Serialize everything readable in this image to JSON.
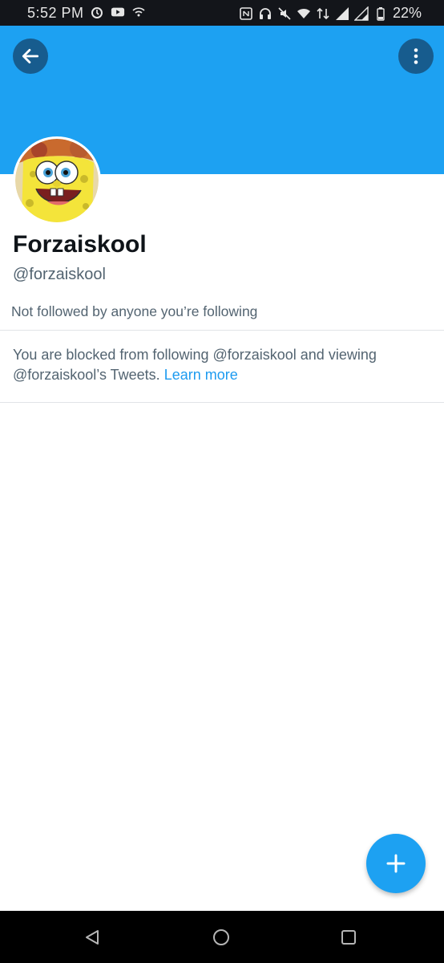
{
  "status_bar": {
    "time": "5:52 PM",
    "battery": "22%",
    "icons": [
      "alarm-icon",
      "youtube-icon",
      "wifi-icon",
      "nfc-icon",
      "headset-icon",
      "mute-icon",
      "wifi-signal-icon",
      "data-icon",
      "cell-signal-icon",
      "battery-icon"
    ]
  },
  "header": {
    "banner_color": "#1da1f2",
    "back_icon": "arrow-left-icon",
    "more_icon": "more-vertical-icon"
  },
  "profile": {
    "display_name": "Forzaiskool",
    "handle": "@forzaiskool",
    "followed_by": "Not followed by anyone you’re following",
    "blocked_message": "You are blocked from following @forzaiskool and viewing @forzaiskool’s Tweets.",
    "learn_more": "Learn more"
  },
  "fab": {
    "icon": "plus-icon",
    "color": "#1da1f2"
  },
  "nav_bar": {
    "buttons": [
      "triangle-back-icon",
      "circle-home-icon",
      "square-recents-icon"
    ]
  },
  "colors": {
    "accent": "#1da1f2",
    "link": "#1d9bf0",
    "text_primary": "#0f1419",
    "text_secondary": "#536471"
  }
}
